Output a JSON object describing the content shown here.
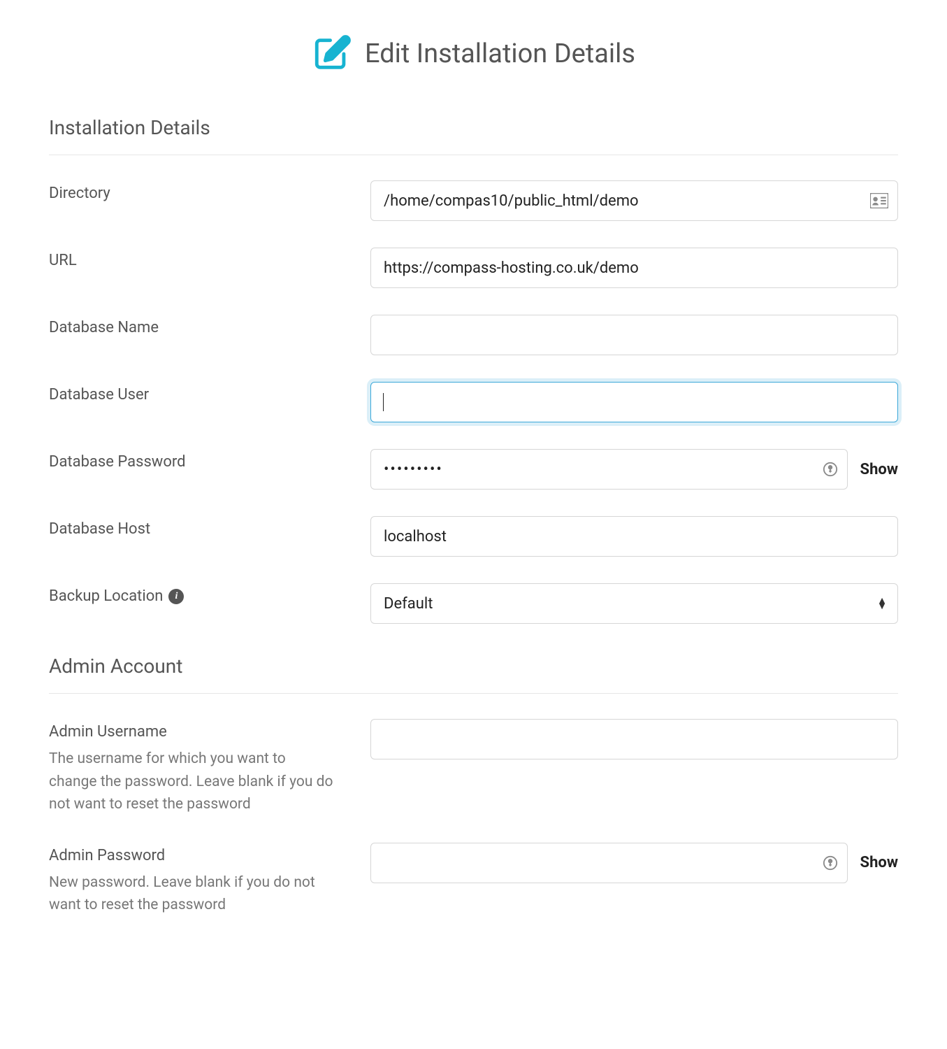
{
  "page": {
    "title": "Edit Installation Details"
  },
  "sections": {
    "install": {
      "heading": "Installation Details"
    },
    "admin": {
      "heading": "Admin Account"
    }
  },
  "install": {
    "directory": {
      "label": "Directory",
      "value": "/home/compas10/public_html/demo"
    },
    "url": {
      "label": "URL",
      "value": "https://compass-hosting.co.uk/demo"
    },
    "dbname": {
      "label": "Database Name",
      "value": ""
    },
    "dbuser": {
      "label": "Database User",
      "value": ""
    },
    "dbpass": {
      "label": "Database Password",
      "value": "•••••••••",
      "show": "Show"
    },
    "dbhost": {
      "label": "Database Host",
      "value": "localhost"
    },
    "backup": {
      "label": "Backup Location",
      "selected": "Default"
    }
  },
  "admin": {
    "username": {
      "label": "Admin Username",
      "help": "The username for which you want to change the password. Leave blank if you do not want to reset the password",
      "value": ""
    },
    "password": {
      "label": "Admin Password",
      "help": "New password. Leave blank if you do not want to reset the password",
      "value": "",
      "show": "Show"
    }
  }
}
